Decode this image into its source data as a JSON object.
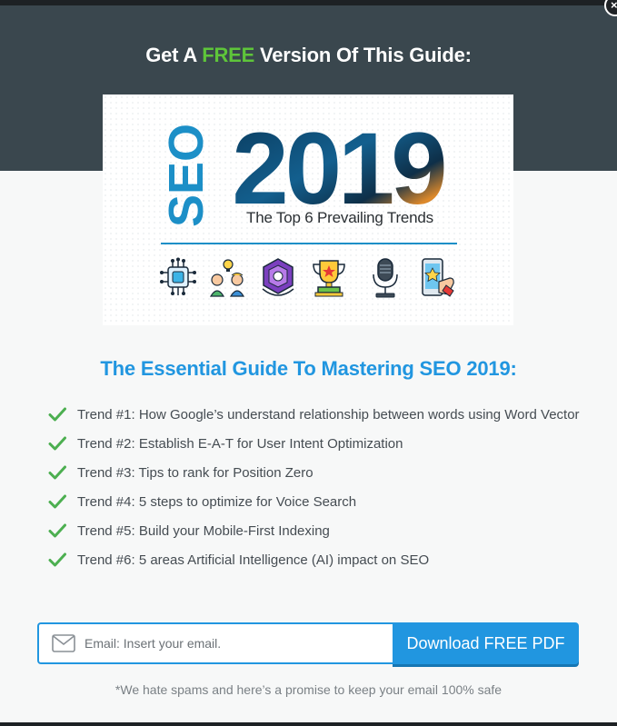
{
  "header": {
    "title_before": "Get A ",
    "title_free": "FREE",
    "title_after": " Version Of This Guide:"
  },
  "close": {
    "label": "×"
  },
  "cover": {
    "seo": "SEO",
    "year": "2019",
    "subtitle": "The Top 6 Prevailing Trends",
    "icons": [
      "ai-chip-icon",
      "people-idea-icon",
      "badge-icon",
      "trophy-icon",
      "microphone-icon",
      "mobile-star-icon"
    ]
  },
  "guide": {
    "title": "The Essential Guide To Mastering SEO 2019:"
  },
  "trends": [
    "Trend #1: How Google’s understand relationship between words using Word Vector",
    "Trend #2: Establish E-A-T for User Intent Optimization",
    "Trend #3: Tips to rank for Position Zero",
    "Trend #4: 5 steps to optimize for Voice Search",
    "Trend #5: Build your Mobile-First Indexing",
    "Trend #6: 5 areas Artificial Intelligence (AI) impact on SEO"
  ],
  "form": {
    "email_placeholder": "Email: Insert your email.",
    "email_value": "",
    "button_label": "Download FREE PDF"
  },
  "disclaimer": "*We hate spams and here’s a promise to keep your email 100% safe",
  "colors": {
    "header_bg": "#3a474e",
    "free_green": "#5ec53a",
    "accent_blue": "#2196e0",
    "check_green": "#4caf50"
  }
}
